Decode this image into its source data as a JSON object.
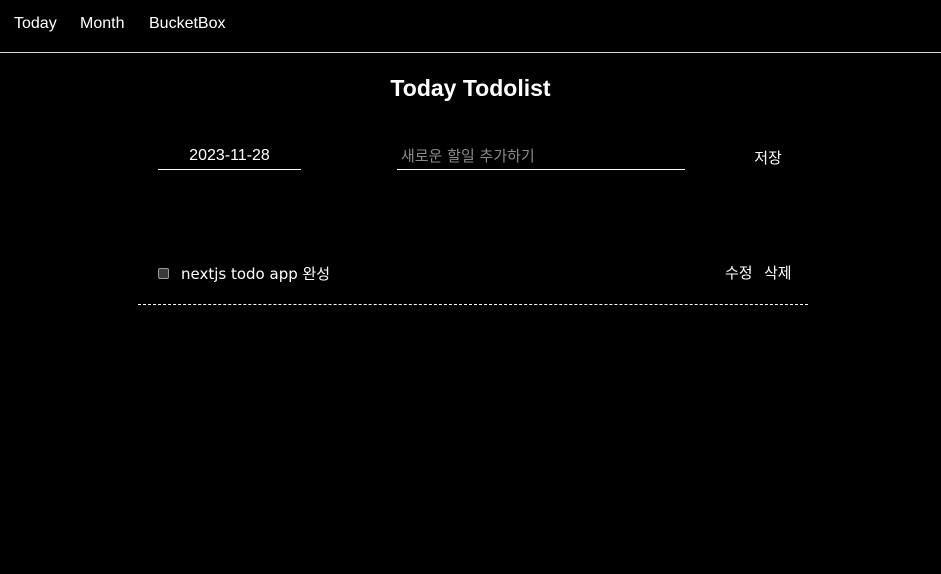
{
  "nav": {
    "today_label": "Today",
    "month_label": "Month",
    "bucketbox_label": "BucketBox"
  },
  "page": {
    "title": "Today Todolist"
  },
  "form": {
    "date_value": "2023-11-28",
    "todo_placeholder": "새로운 할일 추가하기",
    "todo_value": "",
    "save_label": "저장"
  },
  "todos": [
    {
      "text": "nextjs todo app 완성",
      "checked": false,
      "edit_label": "수정",
      "delete_label": "삭제"
    }
  ],
  "colors": {
    "background": "#000000",
    "text": "#ffffff",
    "placeholder": "#8a8a8a"
  }
}
